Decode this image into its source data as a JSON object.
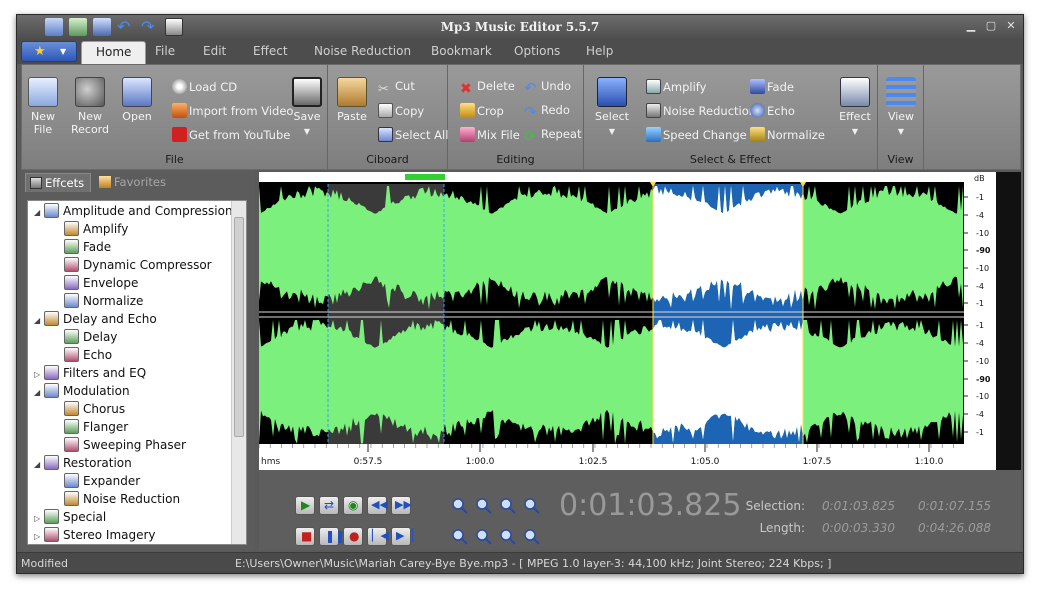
{
  "window": {
    "title": "Mp3 Music Editor 5.5.7",
    "accent": "#2d58b8"
  },
  "tabs": [
    "Home",
    "File",
    "Edit",
    "Effect",
    "Noise Reduction",
    "Bookmark",
    "Options",
    "Help"
  ],
  "ribbon": {
    "file": {
      "group_label": "File",
      "new_file": "New\nFile",
      "new_record": "New\nRecord",
      "open": "Open",
      "load_cd": "Load CD",
      "import_video": "Import from Video",
      "youtube": "Get from YouTube",
      "save": "Save"
    },
    "clipboard": {
      "group_label": "Ciboard",
      "paste": "Paste",
      "cut": "Cut",
      "copy": "Copy",
      "select_all": "Select All"
    },
    "editing": {
      "group_label": "Editing",
      "delete": "Delete",
      "crop": "Crop",
      "mix_file": "Mix File",
      "undo": "Undo",
      "redo": "Redo",
      "repeat": "Repeat"
    },
    "select_effect": {
      "group_label": "Select & Effect",
      "select": "Select",
      "amplify": "Amplify",
      "noise_reduction": "Noise Reduction",
      "speed_change": "Speed Change",
      "fade": "Fade",
      "echo": "Echo",
      "normalize": "Normalize",
      "effect": "Effect"
    },
    "view": {
      "group_label": "View",
      "view": "View"
    }
  },
  "panel": {
    "tab_effects": "Effcets",
    "tab_favorites": "Favorites"
  },
  "tree": [
    {
      "label": "Amplitude and Compression",
      "level": 0,
      "toggle": "collapse"
    },
    {
      "label": "Amplify",
      "level": 1
    },
    {
      "label": "Fade",
      "level": 1
    },
    {
      "label": "Dynamic Compressor",
      "level": 1
    },
    {
      "label": "Envelope",
      "level": 1
    },
    {
      "label": "Normalize",
      "level": 1
    },
    {
      "label": "Delay and Echo",
      "level": 0,
      "toggle": "collapse"
    },
    {
      "label": "Delay",
      "level": 1
    },
    {
      "label": "Echo",
      "level": 1
    },
    {
      "label": "Filters and EQ",
      "level": 0,
      "toggle": "expand"
    },
    {
      "label": "Modulation",
      "level": 0,
      "toggle": "collapse"
    },
    {
      "label": "Chorus",
      "level": 1
    },
    {
      "label": "Flanger",
      "level": 1
    },
    {
      "label": "Sweeping Phaser",
      "level": 1
    },
    {
      "label": "Restoration",
      "level": 0,
      "toggle": "collapse"
    },
    {
      "label": "Expander",
      "level": 1
    },
    {
      "label": "Noise Reduction",
      "level": 1
    },
    {
      "label": "Special",
      "level": 0,
      "toggle": "expand"
    },
    {
      "label": "Stereo Imagery",
      "level": 0,
      "toggle": "expand"
    }
  ],
  "waveform": {
    "db_header": "dB",
    "db_scale": [
      "-1",
      "-4",
      "-10",
      "-90",
      "-10",
      "-4",
      "-1"
    ],
    "time_unit": "hms",
    "time_ticks": [
      "0:57.5",
      "1:00.0",
      "1:02.5",
      "1:05.0",
      "1:07.5",
      "1:10.0"
    ],
    "wave_color": "#7cf07c",
    "selection_color": "#1e64b4"
  },
  "transport": {
    "current_time": "0:01:03.825",
    "selection_label": "Selection:",
    "length_label": "Length:",
    "selection_start": "0:01:03.825",
    "selection_end": "0:01:07.155",
    "length_selection": "0:00:03.330",
    "length_total": "0:04:26.088"
  },
  "status": {
    "state": "Modified",
    "file_info": "E:\\Users\\Owner\\Music\\Mariah Carey-Bye Bye.mp3 - [ MPEG 1.0 layer-3: 44,100 kHz; Joint Stereo; 224 Kbps;  ]"
  }
}
